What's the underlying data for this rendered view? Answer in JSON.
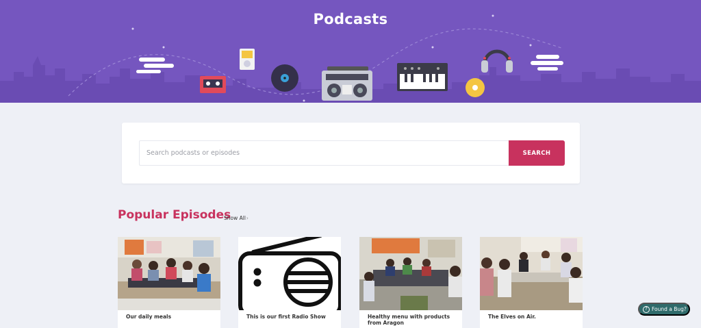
{
  "header": {
    "title": "Podcasts"
  },
  "search": {
    "placeholder": "Search podcasts or episodes",
    "button_label": "SEARCH"
  },
  "popular": {
    "title": "Popular Episodes",
    "show_all": "Show All",
    "episodes": [
      {
        "title": "Our daily meals"
      },
      {
        "title": "This is our first Radio Show"
      },
      {
        "title": "Healthy menu with products from Aragon"
      },
      {
        "title": "The Elves on Air."
      }
    ]
  },
  "bug_button": {
    "label": "Found a Bug?",
    "icon": "help-circle-icon"
  },
  "colors": {
    "hero": "#7556bf",
    "accent": "#c8325e",
    "bug_button": "#2f6b6b",
    "page_bg": "#eef0f6"
  }
}
